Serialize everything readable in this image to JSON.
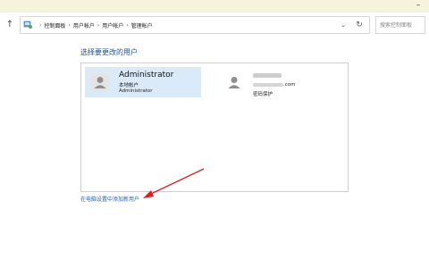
{
  "window": {
    "minimize_label": "–"
  },
  "nav": {
    "up_label": "↑"
  },
  "breadcrumb": {
    "items": [
      "控制面板",
      "用户帐户",
      "用户帐户",
      "管理帐户"
    ],
    "separator": "›",
    "dropdown_label": "⌄",
    "refresh_label": "↻"
  },
  "search": {
    "placeholder": "搜索控制面板"
  },
  "main": {
    "heading": "选择要更改的用户",
    "accounts": [
      {
        "name": "Administrator",
        "type": "本地帐户",
        "detail": "Administrator"
      },
      {
        "name": "",
        "email_suffix": ".com",
        "status": "密码保护"
      }
    ],
    "add_user_link": "在电脑设置中添加新用户"
  },
  "colors": {
    "accent_link": "#1f5fb5",
    "heading": "#1f4e9c",
    "selected_tile": "#dbeaf8",
    "annotation_arrow": "#e02020"
  },
  "icons": [
    "arrow-up-icon",
    "control-panel-icon",
    "chevron-down-icon",
    "refresh-icon",
    "user-avatar-icon"
  ]
}
